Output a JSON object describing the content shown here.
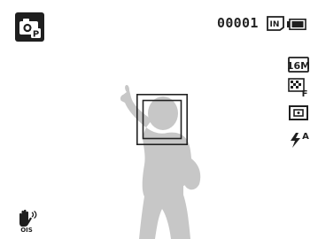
{
  "status_bar": {
    "mode_icon": "smart-camera-p-mode-icon",
    "shots_remaining": "00001",
    "memory_icon": "internal-memory-icon",
    "battery_icon": "battery-full-icon"
  },
  "side_settings": [
    {
      "icon": "resolution-16m-icon",
      "label": "16M"
    },
    {
      "icon": "quality-fine-icon",
      "label": "F"
    },
    {
      "icon": "metering-icon"
    },
    {
      "icon": "flash-auto-icon",
      "label": "A"
    }
  ],
  "bottom": {
    "ois_icon": "ois-icon",
    "ois_label": "OIS"
  },
  "colors": {
    "icon": "#1f1f1f",
    "subject": "#c7c7c7",
    "focus_frame": "#222222"
  }
}
